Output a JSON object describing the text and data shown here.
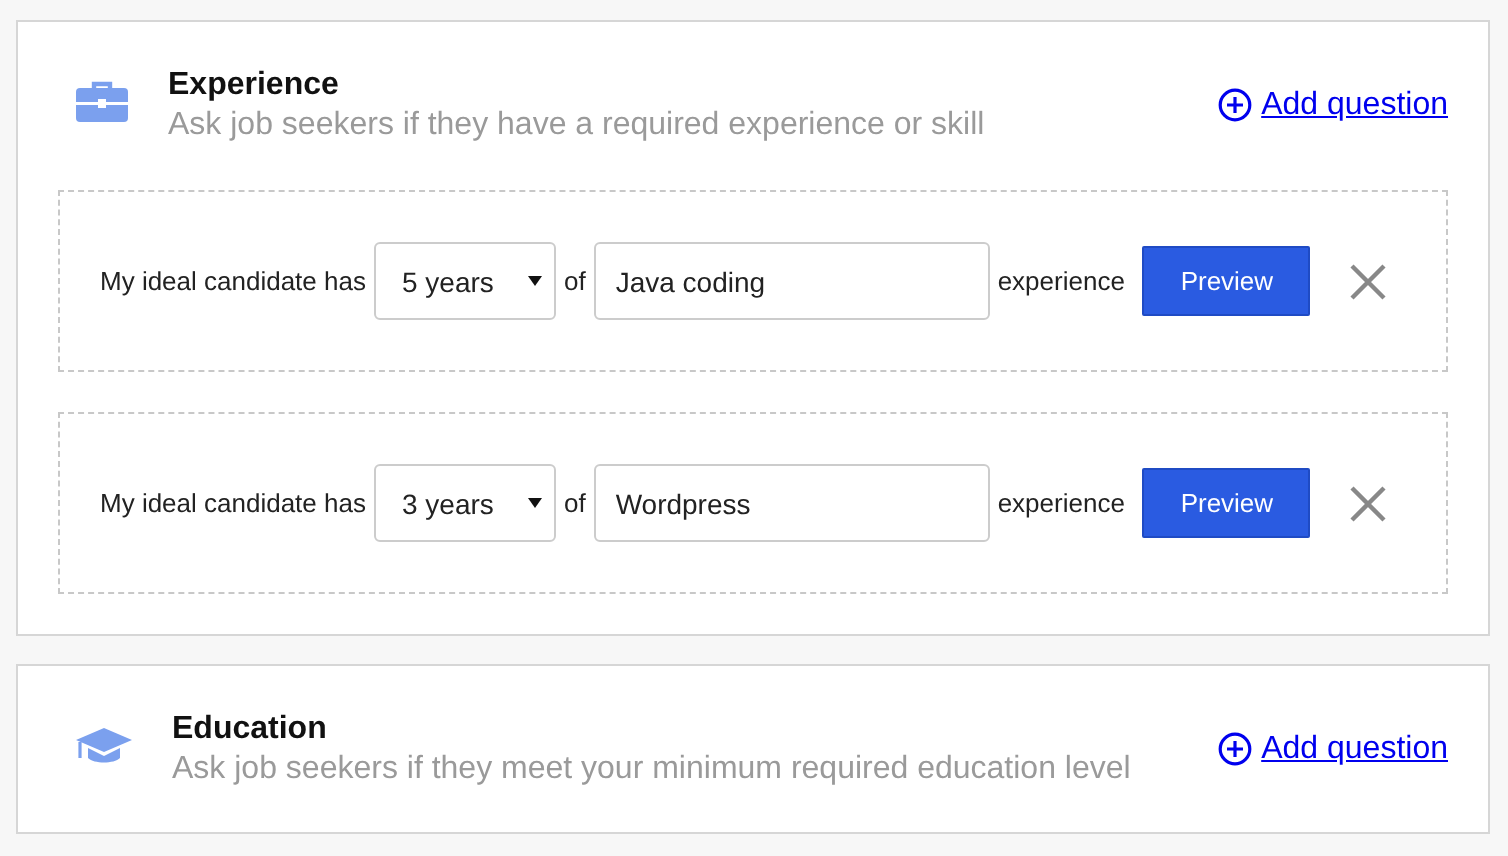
{
  "sections": [
    {
      "kind": "briefcase",
      "title": "Experience",
      "subtitle": "Ask job seekers if they have a required experience or skill",
      "add_label": "Add question",
      "questions": [
        {
          "prefix": "My ideal candidate has",
          "duration": "5 years",
          "of": "of",
          "skill": "Java coding",
          "suffix": "experience",
          "button": "Preview"
        },
        {
          "prefix": "My ideal candidate has",
          "duration": "3 years",
          "of": "of",
          "skill": "Wordpress",
          "suffix": "experience",
          "button": "Preview"
        }
      ]
    },
    {
      "kind": "graduation-cap",
      "title": "Education",
      "subtitle": "Ask job seekers if they meet your minimum required education level",
      "add_label": "Add question"
    }
  ]
}
